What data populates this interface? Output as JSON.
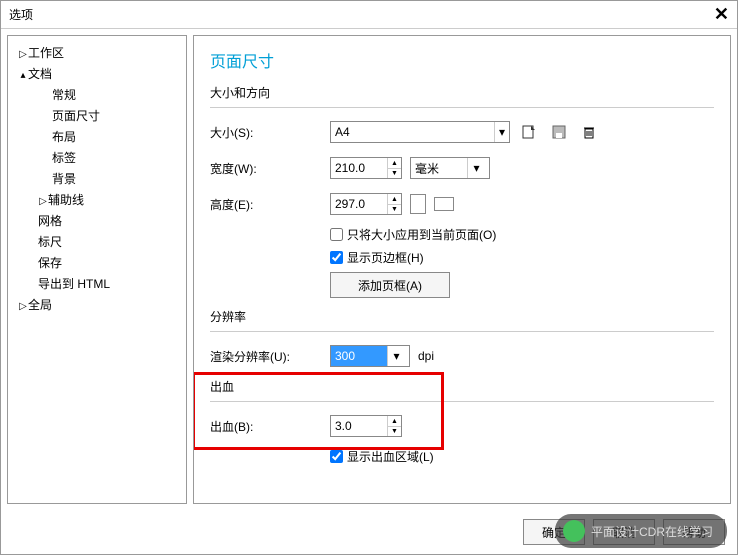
{
  "title": "选项",
  "tree": {
    "workspace": "工作区",
    "document": "文档",
    "doc_children": {
      "general": "常规",
      "page_size": "页面尺寸",
      "layout": "布局",
      "labels": "标签",
      "background": "背景"
    },
    "guidelines": "辅助线",
    "grid": "网格",
    "ruler": "标尺",
    "save": "保存",
    "export_html": "导出到 HTML",
    "global": "全局"
  },
  "main": {
    "heading": "页面尺寸",
    "size_section": "大小和方向",
    "size_label": "大小(S):",
    "size_value": "A4",
    "width_label": "宽度(W):",
    "width_value": "210.0",
    "unit_value": "毫米",
    "height_label": "高度(E):",
    "height_value": "297.0",
    "apply_current": "只将大小应用到当前页面(O)",
    "show_border": "显示页边框(H)",
    "add_frame": "添加页框(A)",
    "res_section": "分辨率",
    "render_res_label": "渲染分辨率(U):",
    "render_res_value": "300",
    "dpi": "dpi",
    "bleed_section": "出血",
    "bleed_label": "出血(B):",
    "bleed_value": "3.0",
    "show_bleed": "显示出血区域(L)"
  },
  "buttons": {
    "ok": "确定",
    "cancel": "取消",
    "help": "帮助"
  },
  "overlay_text": "平面设计CDR在线学习"
}
